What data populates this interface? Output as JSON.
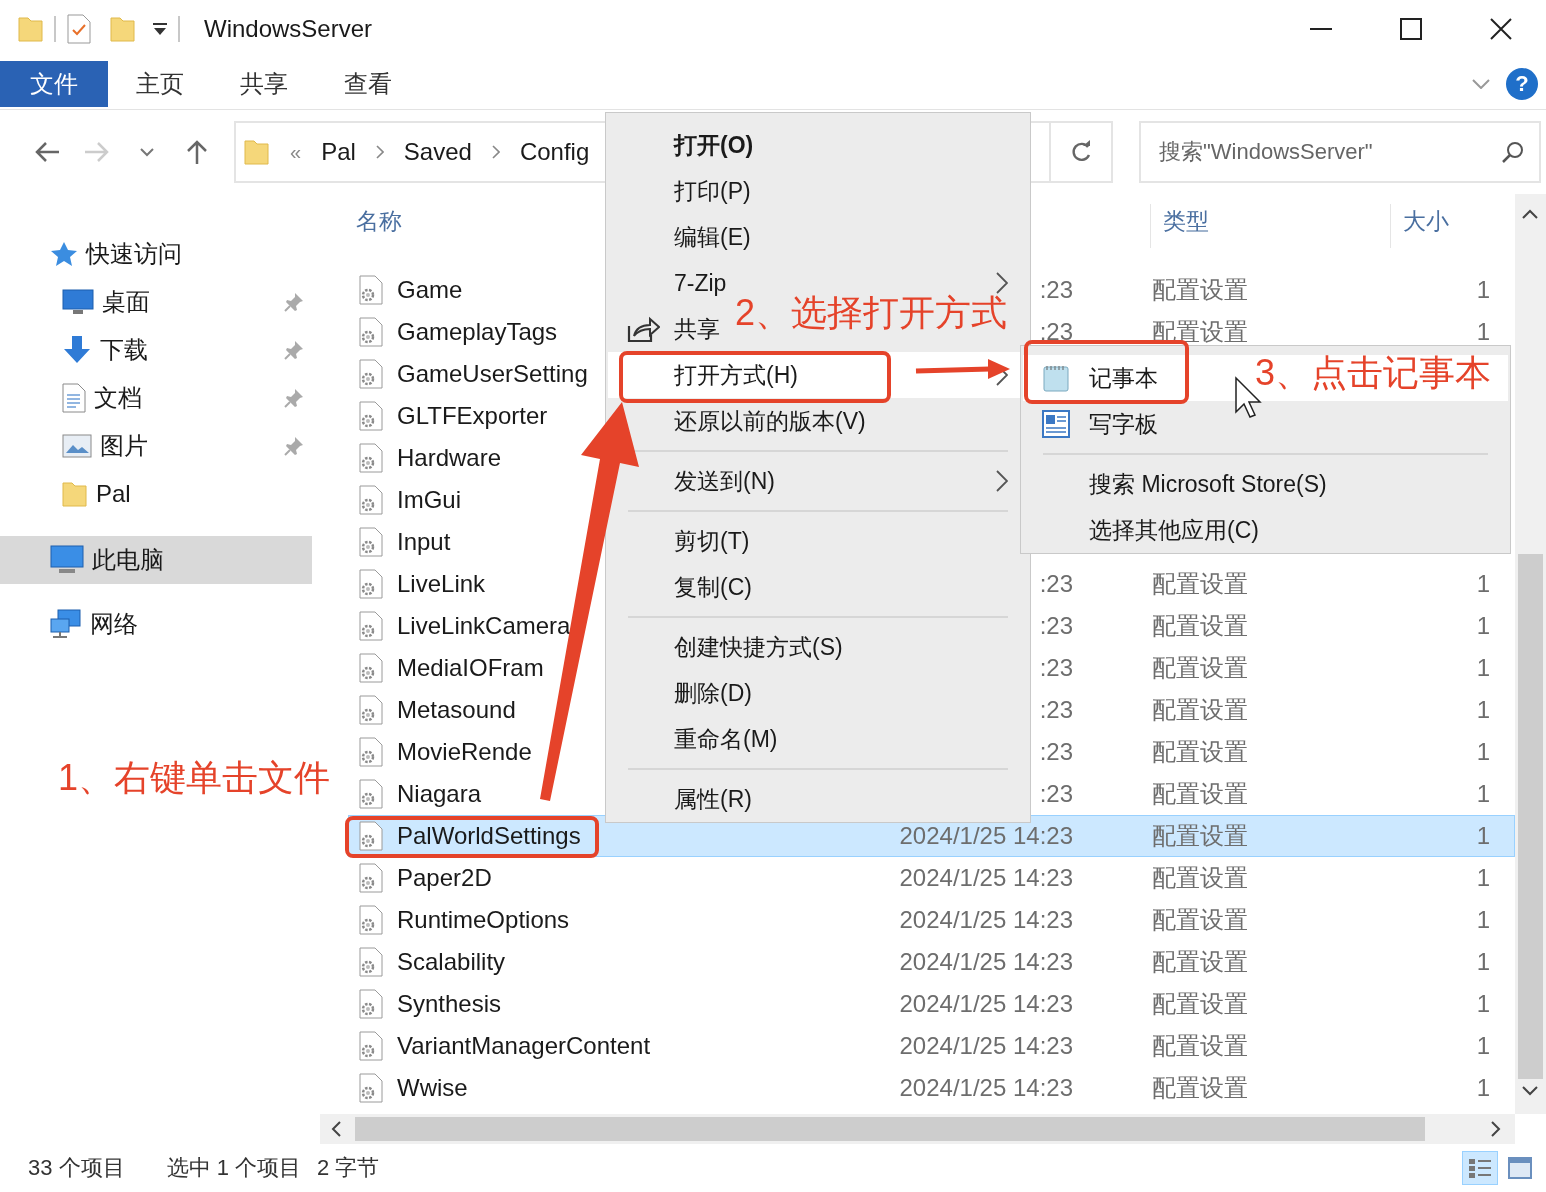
{
  "title_bar": {
    "title": "WindowsServer"
  },
  "ribbon_tabs": [
    {
      "label": "文件",
      "selected": true
    },
    {
      "label": "主页",
      "selected": false
    },
    {
      "label": "共享",
      "selected": false
    },
    {
      "label": "查看",
      "selected": false
    }
  ],
  "help_button": "?",
  "address_bar": {
    "overflow": "«",
    "path": [
      "Pal",
      "Saved",
      "Config"
    ]
  },
  "search_box": {
    "placeholder": "搜索\"WindowsServer\""
  },
  "sidebar": {
    "items": [
      {
        "kind": "quick-access",
        "label": "快速访问",
        "pinned": false,
        "selected": false
      },
      {
        "kind": "desktop",
        "label": "桌面",
        "pinned": true,
        "selected": false
      },
      {
        "kind": "downloads",
        "label": "下载",
        "pinned": true,
        "selected": false
      },
      {
        "kind": "documents",
        "label": "文档",
        "pinned": true,
        "selected": false
      },
      {
        "kind": "pictures",
        "label": "图片",
        "pinned": true,
        "selected": false
      },
      {
        "kind": "folder",
        "label": "Pal",
        "pinned": false,
        "selected": false
      },
      {
        "kind": "computer",
        "label": "此电脑",
        "pinned": false,
        "selected": true
      },
      {
        "kind": "network",
        "label": "网络",
        "pinned": false,
        "selected": false
      }
    ]
  },
  "column_headers": {
    "name": "名称",
    "type": "类型",
    "size": "大小"
  },
  "files": [
    {
      "name": "Game",
      "modified": ":23",
      "type": "配置设置",
      "size": "1",
      "selected": false
    },
    {
      "name": "GameplayTags",
      "modified": ":23",
      "type": "配置设置",
      "size": "1",
      "selected": false
    },
    {
      "name": "GameUserSetting",
      "selected": false
    },
    {
      "name": "GLTFExporter",
      "selected": false
    },
    {
      "name": "Hardware",
      "selected": false
    },
    {
      "name": "ImGui",
      "selected": false
    },
    {
      "name": "Input",
      "selected": false
    },
    {
      "name": "LiveLink",
      "modified": ":23",
      "type": "配置设置",
      "size": "1",
      "selected": false
    },
    {
      "name": "LiveLinkCamera",
      "modified": ":23",
      "type": "配置设置",
      "size": "1",
      "selected": false
    },
    {
      "name": "MediaIOFram",
      "modified": ":23",
      "type": "配置设置",
      "size": "1",
      "selected": false
    },
    {
      "name": "Metasound",
      "modified": ":23",
      "type": "配置设置",
      "size": "1",
      "selected": false
    },
    {
      "name": "MovieRende",
      "modified": ":23",
      "type": "配置设置",
      "size": "1",
      "selected": false
    },
    {
      "name": "Niagara",
      "modified": ":23",
      "type": "配置设置",
      "size": "1",
      "selected": false
    },
    {
      "name": "PalWorldSettings",
      "modified": "2024/1/25 14:23",
      "type": "配置设置",
      "size": "1",
      "selected": true
    },
    {
      "name": "Paper2D",
      "modified": "2024/1/25 14:23",
      "type": "配置设置",
      "size": "1",
      "selected": false
    },
    {
      "name": "RuntimeOptions",
      "modified": "2024/1/25 14:23",
      "type": "配置设置",
      "size": "1",
      "selected": false
    },
    {
      "name": "Scalability",
      "modified": "2024/1/25 14:23",
      "type": "配置设置",
      "size": "1",
      "selected": false
    },
    {
      "name": "Synthesis",
      "modified": "2024/1/25 14:23",
      "type": "配置设置",
      "size": "1",
      "selected": false
    },
    {
      "name": "VariantManagerContent",
      "modified": "2024/1/25 14:23",
      "type": "配置设置",
      "size": "1",
      "selected": false
    },
    {
      "name": "Wwise",
      "modified": "2024/1/25 14:23",
      "type": "配置设置",
      "size": "1",
      "selected": false
    }
  ],
  "context_menu": {
    "items": [
      {
        "kind": "item",
        "label": "打开(O)",
        "default": true,
        "submenu": false,
        "selected": false
      },
      {
        "kind": "item",
        "label": "打印(P)",
        "default": false,
        "submenu": false,
        "selected": false
      },
      {
        "kind": "item",
        "label": "编辑(E)",
        "default": false,
        "submenu": false,
        "selected": false
      },
      {
        "kind": "item",
        "label": "7-Zip",
        "default": false,
        "submenu": true,
        "selected": false
      },
      {
        "kind": "share",
        "label": "共享",
        "default": false,
        "submenu": false,
        "selected": false
      },
      {
        "kind": "item",
        "label": "打开方式(H)",
        "default": false,
        "submenu": true,
        "selected": true
      },
      {
        "kind": "item",
        "label": "还原以前的版本(V)",
        "default": false,
        "submenu": false,
        "selected": false
      },
      {
        "kind": "separator"
      },
      {
        "kind": "item",
        "label": "发送到(N)",
        "default": false,
        "submenu": true,
        "selected": false
      },
      {
        "kind": "separator"
      },
      {
        "kind": "item",
        "label": "剪切(T)",
        "default": false,
        "submenu": false,
        "selected": false
      },
      {
        "kind": "item",
        "label": "复制(C)",
        "default": false,
        "submenu": false,
        "selected": false
      },
      {
        "kind": "separator"
      },
      {
        "kind": "item",
        "label": "创建快捷方式(S)",
        "default": false,
        "submenu": false,
        "selected": false
      },
      {
        "kind": "item",
        "label": "删除(D)",
        "default": false,
        "submenu": false,
        "selected": false
      },
      {
        "kind": "item",
        "label": "重命名(M)",
        "default": false,
        "submenu": false,
        "selected": false
      },
      {
        "kind": "separator"
      },
      {
        "kind": "item",
        "label": "属性(R)",
        "default": false,
        "submenu": false,
        "selected": false
      }
    ]
  },
  "open_with_menu": {
    "items": [
      {
        "kind": "notepad",
        "label": "记事本",
        "selected": true
      },
      {
        "kind": "wordpad",
        "label": "写字板",
        "selected": false
      },
      {
        "kind": "separator"
      },
      {
        "kind": "item",
        "label": "搜索 Microsoft Store(S)",
        "selected": false
      },
      {
        "kind": "item",
        "label": "选择其他应用(C)",
        "selected": false
      }
    ]
  },
  "annotations": [
    {
      "text": "1、右键单击文件"
    },
    {
      "text": "2、选择打开方式"
    },
    {
      "text": "3、点击记事本"
    }
  ],
  "status_bar": {
    "item_count": "33 个项目",
    "selection": "选中 1 个项目",
    "size": "2 字节"
  },
  "view_buttons": [
    {
      "kind": "details",
      "selected": true
    },
    {
      "kind": "large-icons",
      "selected": false
    }
  ]
}
